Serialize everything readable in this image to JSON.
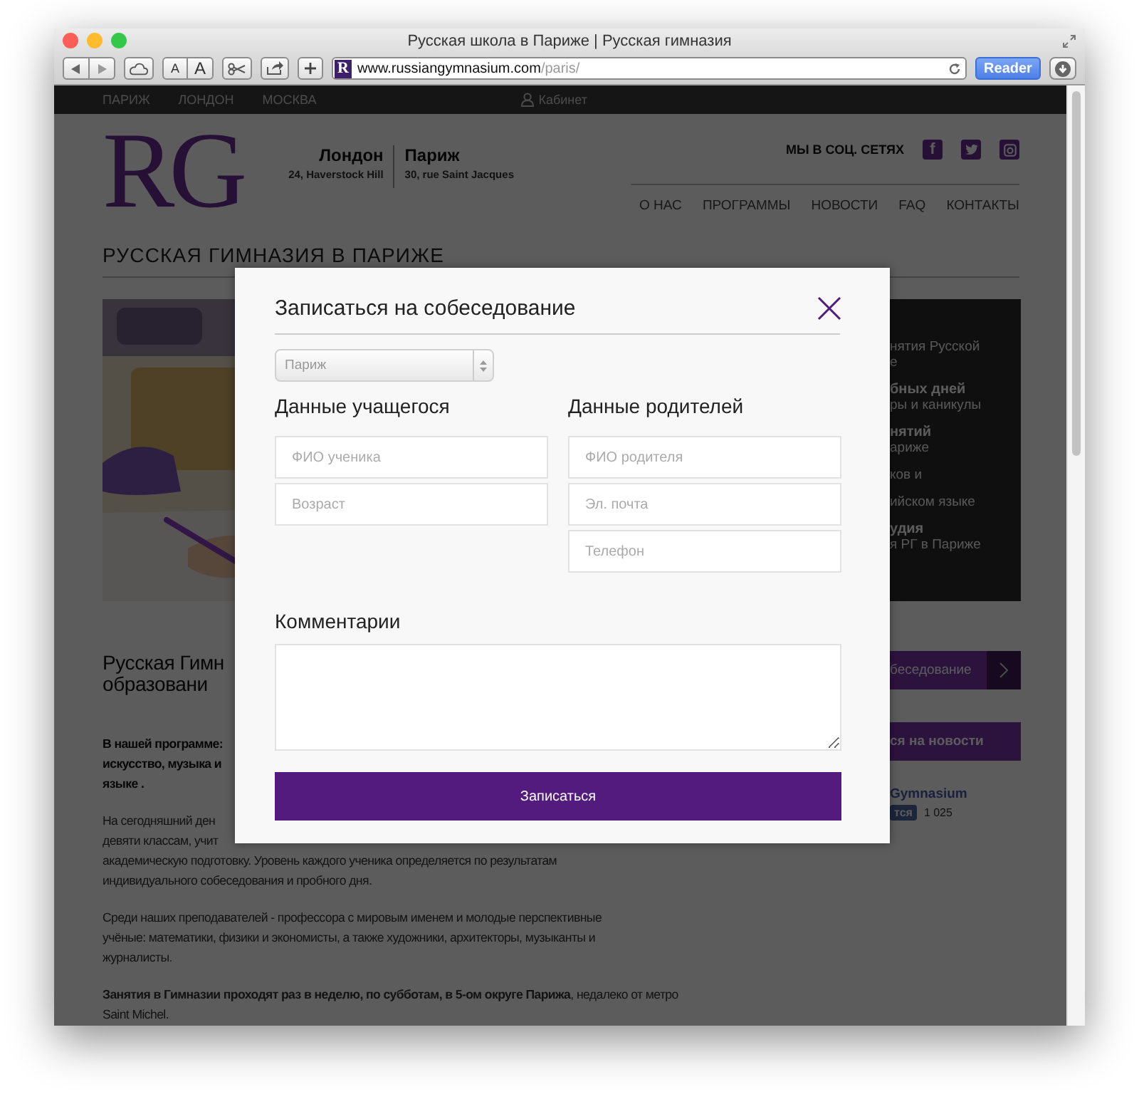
{
  "browser": {
    "title": "Русская школа в Париже | Русская гимназия",
    "text_smaller": "A",
    "text_bigger": "A",
    "favicon": "R",
    "url_host": "www.russiangymnasium.com",
    "url_path": "/paris/",
    "reader": "Reader"
  },
  "top_bar": {
    "cities": [
      "ПАРИЖ",
      "ЛОНДОН",
      "МОСКВА"
    ],
    "account": "Кабинет"
  },
  "header": {
    "logo": "RG",
    "addresses": [
      {
        "city": "Лондон",
        "street": "24, Haverstock Hill"
      },
      {
        "city": "Париж",
        "street": "30, rue Saint Jacques"
      }
    ],
    "social_label": "МЫ В СОЦ. СЕТЯХ",
    "social": [
      {
        "kind": "facebook",
        "glyph": "f"
      },
      {
        "kind": "twitter"
      },
      {
        "kind": "instagram"
      }
    ],
    "menu": [
      "О НАС",
      "ПРОГРАММЫ",
      "НОВОСТИ",
      "FAQ",
      "КОНТАКТЫ"
    ]
  },
  "page_title": "РУССКАЯ ГИМНАЗИЯ В ПАРИЖЕ",
  "main": {
    "heading_lines": [
      "Русская Гимн",
      "образовани"
    ],
    "paragraphs": [
      {
        "bold": true,
        "lines": [
          "В нашей программе:",
          "искусство, музыка и",
          "языке ."
        ]
      },
      {
        "bold": false,
        "lines": [
          "На сегодняшний ден",
          "девяти классам, учит",
          "академическую подготовку. Уровень каждого ученика определяется по результатам",
          "индивидуального собеседования и пробного дня."
        ]
      },
      {
        "bold": false,
        "lines": [
          "Среди наших преподавателей - профессора с мировым именем и молодые перспективные",
          "учёные: математики, физики и экономисты, а также художники, архитекторы, музыканты и",
          "журналисты."
        ]
      },
      {
        "bold": false,
        "lines": [
          "**Занятия в Гимназии проходят раз в неделю, по субботам, в 5-ом округе Парижа**, недалеко от метро",
          "Saint Michel."
        ]
      }
    ]
  },
  "sidebar": {
    "panel_items": [
      {
        "lines": [
          "нятия Русской",
          "е"
        ]
      },
      {
        "title": "бных дней",
        "lines": [
          "ры и каникулы"
        ]
      },
      {
        "title": "нятий",
        "lines": [
          "ариже"
        ]
      },
      {
        "lines": [
          "ков и"
        ]
      },
      {
        "lines": [
          "ийском языке"
        ]
      },
      {
        "title": "удия",
        "lines": [
          "я РГ в Париже"
        ]
      }
    ],
    "interview_button": "беседование",
    "subscribe_button": "ся на новости",
    "fb_page": "Gymnasium",
    "fb_like": "тся",
    "fb_count": "1 025"
  },
  "modal": {
    "title": "Записаться на собеседование",
    "city_select": "Париж",
    "student_heading": "Данные учащегося",
    "student_fields": [
      {
        "placeholder": "ФИО ученика"
      },
      {
        "placeholder": "Возраст"
      }
    ],
    "parent_heading": "Данные родителей",
    "parent_fields": [
      {
        "placeholder": "ФИО родителя"
      },
      {
        "placeholder": "Эл. почта"
      },
      {
        "placeholder": "Телефон"
      }
    ],
    "comments_heading": "Комментарии",
    "submit": "Записаться"
  }
}
